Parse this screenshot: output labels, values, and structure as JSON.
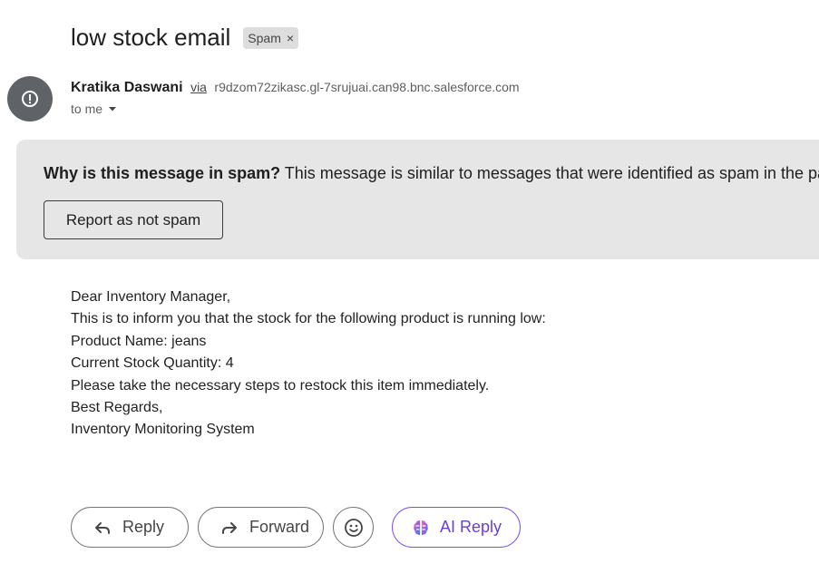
{
  "email": {
    "subject": "low stock email",
    "label_chip": "Spam",
    "label_remove_glyph": "×",
    "sender_name": "Kratika Daswani",
    "via_text": "via",
    "sender_address": "r9dzom72zikasc.gl-7srujuai.can98.bnc.salesforce.com",
    "recipient_text": "to me",
    "avatar_icon": "alert-circle-icon"
  },
  "spam_banner": {
    "question": "Why is this message in spam?",
    "explanation": "This message is similar to messages that were identified as spam in the past.",
    "report_button": "Report as not spam"
  },
  "body_lines": [
    "Dear Inventory Manager,",
    "This is to inform you that the stock for the following product is running low:",
    "Product Name: jeans",
    "Current Stock Quantity: 4",
    "Please take the necessary steps to restock this item immediately.",
    "Best Regards,",
    "Inventory Monitoring System"
  ],
  "actions": {
    "reply_label": "Reply",
    "forward_label": "Forward",
    "ai_reply_label": "AI Reply",
    "emoji_icon": "smiley-icon"
  },
  "colors": {
    "banner_bg": "#e6e6e6",
    "avatar_bg": "#5f6368",
    "ai_accent": "#6a3fd8"
  }
}
